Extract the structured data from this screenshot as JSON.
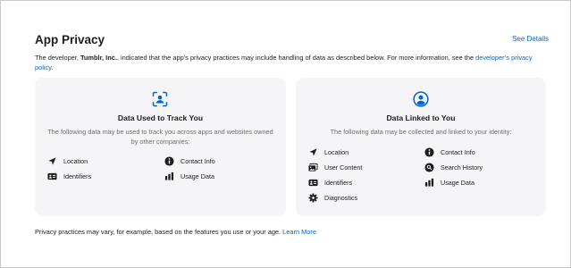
{
  "section": {
    "title": "App Privacy",
    "see_details": "See Details",
    "desc_prefix": "The developer, ",
    "developer": "Tumblr, Inc.",
    "desc_suffix": ", indicated that the app’s privacy practices may include handling of data as described below. For more information, see the ",
    "policy_link": "developer’s privacy policy",
    "desc_end": "."
  },
  "cards": {
    "track": {
      "title": "Data Used to Track You",
      "subtitle": "The following data may be used to track you across apps and websites owned by other companies:",
      "icon": "tracking-icon",
      "items": [
        {
          "label": "Location",
          "icon": "location-arrow-icon"
        },
        {
          "label": "Contact Info",
          "icon": "info-circle-icon"
        },
        {
          "label": "Identifiers",
          "icon": "id-card-icon"
        },
        {
          "label": "Usage Data",
          "icon": "bar-chart-icon"
        }
      ]
    },
    "linked": {
      "title": "Data Linked to You",
      "subtitle": "The following data may be collected and linked to your identity:",
      "icon": "person-circle-icon",
      "items": [
        {
          "label": "Location",
          "icon": "location-arrow-icon"
        },
        {
          "label": "Contact Info",
          "icon": "info-circle-icon"
        },
        {
          "label": "User Content",
          "icon": "photo-stack-icon"
        },
        {
          "label": "Search History",
          "icon": "search-circle-icon"
        },
        {
          "label": "Identifiers",
          "icon": "id-card-icon"
        },
        {
          "label": "Usage Data",
          "icon": "bar-chart-icon"
        },
        {
          "label": "Diagnostics",
          "icon": "gear-icon"
        }
      ]
    }
  },
  "footer": {
    "text": "Privacy practices may vary, for example, based on the features you use or your age. ",
    "learn_more": "Learn More"
  },
  "colors": {
    "accent": "#0066cc",
    "card_bg": "#f5f5f7",
    "text": "#1d1d1f",
    "muted": "#6e6e73"
  }
}
